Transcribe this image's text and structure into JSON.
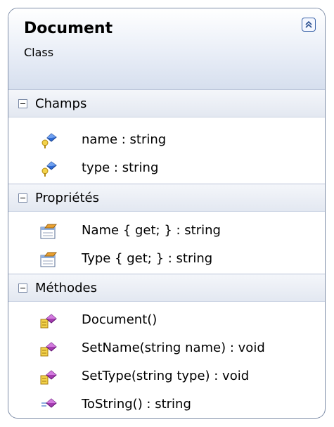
{
  "class": {
    "name": "Document",
    "stereotype": "Class",
    "collapse_icon": "double-chevron-up-icon"
  },
  "sections": {
    "fields": {
      "title": "Champs",
      "items": [
        "name : string",
        "type : string"
      ]
    },
    "properties": {
      "title": "Propriétés",
      "items": [
        "Name { get; } : string",
        "Type { get; } : string"
      ]
    },
    "methods": {
      "title": "Méthodes",
      "items": [
        "Document()",
        "SetName(string name) : void",
        "SetType(string type) : void",
        "ToString() : string"
      ]
    }
  },
  "colors": {
    "border": "#7f8ea8",
    "header_gradient_bottom": "#d6dfee",
    "section_bg": "#e3e8f1",
    "method_icon": "#a43bb0",
    "field_icon": "#2e6ad4",
    "key_icon": "#e0b020"
  }
}
